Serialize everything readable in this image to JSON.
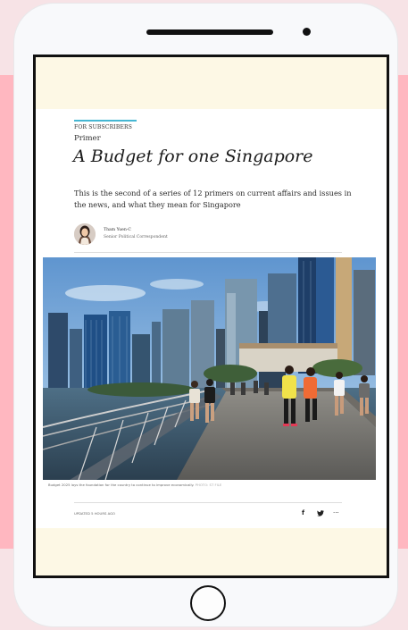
{
  "article": {
    "kicker": "FOR SUBSCRIBERS",
    "section": "Primer",
    "headline": "A Budget for one Singapore",
    "standfirst_line1": "This is the second of a series of 12 primers on current affairs and issues in",
    "standfirst_line2": "the news, and what they mean for Singapore",
    "author_name": "Tham Yuen-C",
    "author_role": "Senior Political Correspondent",
    "caption": "Budget 2025 lays the foundation for the country to continue to improve economically.",
    "photo_credit": "PHOTO: ST FILE",
    "updated": "UPDATED 5 HOURS AGO",
    "share_facebook": "f",
    "share_twitter": "🐦",
    "share_more": "···"
  },
  "colors": {
    "background": "#f7e3e6",
    "accent_band": "#ffb7c0",
    "screen_cream": "#fdf8e5",
    "subscriber_rule": "#46b7d3"
  }
}
